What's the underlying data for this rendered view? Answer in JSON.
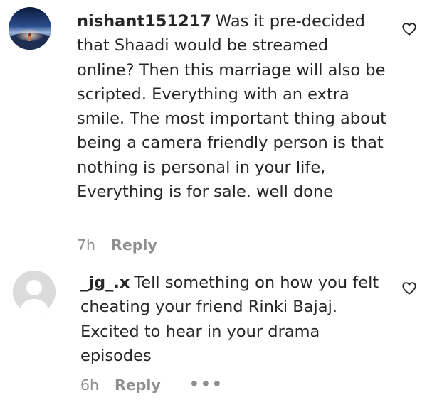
{
  "comments": [
    {
      "username": "nishant151217",
      "text": "Was it pre-decided that Shaadi would be streamed online? Then this marriage will also be scripted. Everything with an extra smile. The most important thing about being a camera friendly person is that nothing is personal in your life, Everything is for sale. well done",
      "time": "7h",
      "reply_label": "Reply",
      "avatar_icon": "profile-photo-space-horizon",
      "like_icon": "heart-outline-icon"
    },
    {
      "username": "_jg_.x",
      "text": "Tell something on how you felt cheating your friend Rinki Bajaj. Excited to hear in your drama episodes",
      "time": "6h",
      "reply_label": "Reply",
      "more_label": "•••",
      "avatar_icon": "default-avatar-icon",
      "like_icon": "heart-outline-icon"
    }
  ]
}
